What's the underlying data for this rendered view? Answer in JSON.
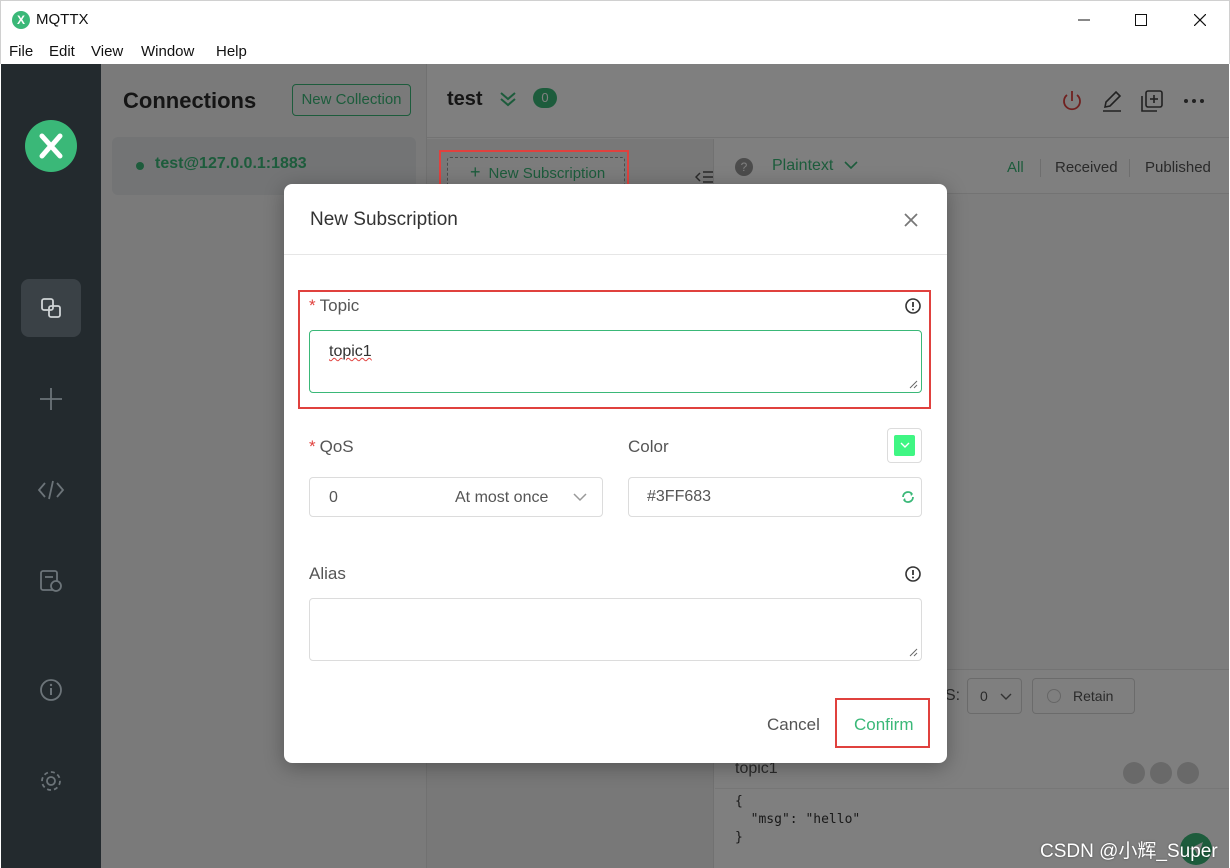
{
  "window": {
    "title": "MQTTX",
    "logo_letter": "X"
  },
  "menu": {
    "items": [
      "File",
      "Edit",
      "View",
      "Window",
      "Help"
    ]
  },
  "nav": {
    "icons": [
      "connections-icon",
      "plus-icon",
      "code-icon",
      "log-icon",
      "info-icon",
      "settings-icon"
    ]
  },
  "connections": {
    "heading": "Connections",
    "new_collection_label": "New Collection",
    "items": [
      {
        "name": "test@127.0.0.1:1883",
        "status_color": "#3ab878"
      }
    ]
  },
  "main": {
    "connection_title": "test",
    "subscription_count": "0",
    "new_subscription_label": "New Subscription",
    "payload_type": "Plaintext",
    "filters": [
      "All",
      "Received",
      "Published"
    ],
    "publish": {
      "qos_label": "S:",
      "qos_value": "0",
      "retain_label": "Retain",
      "topic": "topic1",
      "payload": "{\n  \"msg\": \"hello\"\n}"
    }
  },
  "dialog": {
    "title": "New Subscription",
    "topic_label": "Topic",
    "topic_value": "topic1",
    "required_marker": "*",
    "qos_label": "QoS",
    "qos_value": "0",
    "qos_description": "At most once",
    "color_label": "Color",
    "color_value": "#3FF683",
    "alias_label": "Alias",
    "alias_value": "",
    "cancel_label": "Cancel",
    "confirm_label": "Confirm"
  },
  "colors": {
    "accent": "#3ab878",
    "annotation": "#e0413e",
    "swatch": "#3FF683"
  },
  "watermark": "CSDN @小辉_Super"
}
